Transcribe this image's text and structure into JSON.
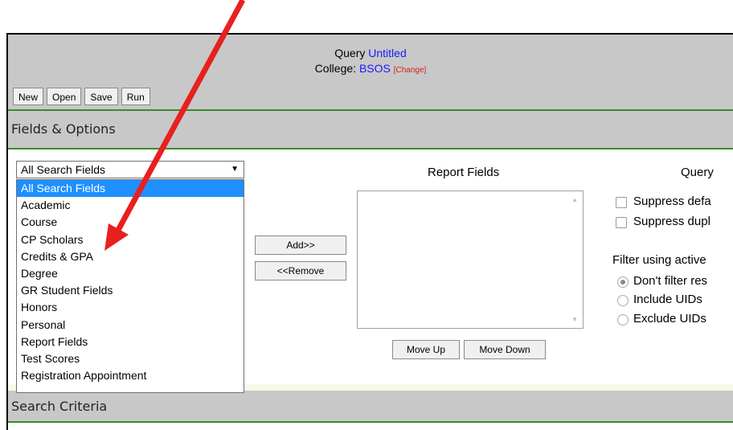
{
  "header": {
    "query_prefix": "Query",
    "query_name": "Untitled",
    "college_prefix": "College:",
    "college_name": "BSOS",
    "change_link": "[Change]"
  },
  "toolbar": {
    "new_label": "New",
    "open_label": "Open",
    "save_label": "Save",
    "run_label": "Run"
  },
  "fields_options": {
    "title": "Fields & Options",
    "search_select_value": "All Search Fields",
    "dropdown_items": [
      "All Search Fields",
      "Academic",
      "Course",
      "CP Scholars",
      "Credits & GPA",
      "Degree",
      "GR Student Fields",
      "Honors",
      "Personal",
      "Report Fields",
      "Test Scores",
      "Registration Appointment"
    ],
    "add_label": "Add>>",
    "remove_label": "<<Remove",
    "report_fields_label": "Report Fields",
    "move_up_label": "Move Up",
    "move_down_label": "Move Down",
    "query_options_label": "Query",
    "suppress_default_label": "Suppress defa",
    "suppress_dup_label": "Suppress dupl",
    "filter_label": "Filter using active",
    "radio_dont_filter": "Don't filter res",
    "radio_include": "Include UIDs",
    "radio_exclude": "Exclude UIDs"
  },
  "search_criteria": {
    "title": "Search Criteria"
  },
  "colors": {
    "link": "#1a1aff",
    "change_link": "#d42020",
    "section_bg": "#c8c8c8",
    "section_border": "#3a8a2a",
    "selected_item": "#1e90ff",
    "annotation_arrow": "#e8201e"
  },
  "icons": {
    "dropdown_arrow": "caret-down-icon",
    "annotation": "red-arrow-icon"
  }
}
